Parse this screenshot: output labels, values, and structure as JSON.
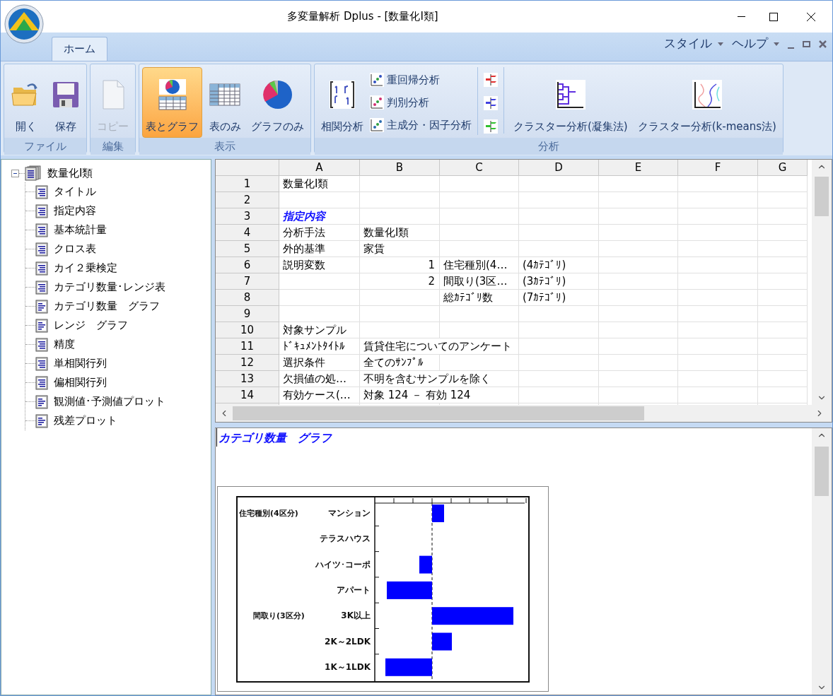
{
  "window": {
    "title": "多変量解析 Dplus - [数量化Ⅰ類]"
  },
  "ribbon": {
    "tabs": [
      {
        "label": "ホーム",
        "selected": true
      }
    ],
    "menus": [
      {
        "label": "スタイル"
      },
      {
        "label": "ヘルプ"
      }
    ],
    "groups": [
      {
        "label": "ファイル",
        "buttons": [
          {
            "kind": "open",
            "label": "開く",
            "disabled": false,
            "selected": false
          },
          {
            "kind": "save",
            "label": "保存",
            "disabled": false,
            "selected": false
          }
        ]
      },
      {
        "label": "編集",
        "buttons": [
          {
            "kind": "copy",
            "label": "コピー",
            "disabled": true,
            "selected": false
          }
        ]
      },
      {
        "label": "表示",
        "buttons": [
          {
            "kind": "table-graph",
            "label": "表とグラフ",
            "disabled": false,
            "selected": true
          },
          {
            "kind": "table",
            "label": "表のみ",
            "disabled": false,
            "selected": false
          },
          {
            "kind": "graph",
            "label": "グラフのみ",
            "disabled": false,
            "selected": false
          }
        ]
      },
      {
        "label": "分析",
        "buttons": [
          {
            "kind": "matrix",
            "label": "相関分析",
            "disabled": false,
            "selected": false
          },
          {
            "kind": "small-list",
            "items": [
              "重回帰分析",
              "判別分析",
              "主成分・因子分析"
            ]
          },
          {
            "kind": "flags"
          },
          {
            "kind": "dendrogram",
            "label": "クラスター分析(凝集法)",
            "disabled": false,
            "selected": false
          },
          {
            "kind": "kmeans",
            "label": "クラスター分析(k-means法)",
            "disabled": false,
            "selected": false
          }
        ]
      }
    ]
  },
  "tree": {
    "label": "数量化Ⅰ類",
    "expanded": true,
    "children": [
      {
        "label": "タイトル",
        "kind": "text"
      },
      {
        "label": "指定内容",
        "kind": "text"
      },
      {
        "label": "基本統計量",
        "kind": "text"
      },
      {
        "label": "クロス表",
        "kind": "text"
      },
      {
        "label": "カイ２乗検定",
        "kind": "text"
      },
      {
        "label": "カテゴリ数量･レンジ表",
        "kind": "text"
      },
      {
        "label": "カテゴリ数量　グラフ",
        "kind": "graph"
      },
      {
        "label": "レンジ　グラフ",
        "kind": "graph"
      },
      {
        "label": "精度",
        "kind": "text"
      },
      {
        "label": "単相関行列",
        "kind": "text"
      },
      {
        "label": "偏相関行列",
        "kind": "text"
      },
      {
        "label": "観測値･予測値プロット",
        "kind": "graph"
      },
      {
        "label": "残差プロット",
        "kind": "graph"
      }
    ]
  },
  "sheet": {
    "columns": [
      "A",
      "B",
      "C",
      "D",
      "E",
      "F",
      "G"
    ],
    "rows": [
      {
        "number": "1",
        "a": "数量化Ⅰ類"
      },
      {
        "number": "2"
      },
      {
        "number": "3",
        "a": "指定内容",
        "kind": "heading"
      },
      {
        "number": "4",
        "a": "分析手法",
        "b": "数量化Ⅰ類"
      },
      {
        "number": "5",
        "a": "外的基準",
        "b": "家賃"
      },
      {
        "number": "6",
        "a": "説明変数",
        "b": "1",
        "c": "住宅種別(4…",
        "d": "(4ｶﾃｺﾞﾘ)"
      },
      {
        "number": "7",
        "b": "2",
        "c": "間取り(3区…",
        "d": "(3ｶﾃｺﾞﾘ)"
      },
      {
        "number": "8",
        "c": "総ｶﾃｺﾞﾘ数",
        "d": "(7ｶﾃｺﾞﾘ)"
      },
      {
        "number": "9"
      },
      {
        "number": "10",
        "a": "対象サンプル"
      },
      {
        "number": "11",
        "a": "ﾄﾞｷｭﾒﾝﾄﾀｲﾄﾙ",
        "b": "賃貸住宅についてのアンケート"
      },
      {
        "number": "12",
        "a": "選択条件",
        "b": "全てのｻﾝﾌﾟﾙ"
      },
      {
        "number": "13",
        "a": "欠損値の処…",
        "b": "不明を含むサンプルを除く"
      },
      {
        "number": "14",
        "a": "有効ケース(…",
        "b": "対象 124 － 有効 124"
      }
    ]
  },
  "graph_pane": {
    "title": "カテゴリ数量　グラフ",
    "chart": {
      "groups": [
        {
          "label": "住宅種別(4区分)",
          "categories": [
            "マンション",
            "テラスハウス",
            "ハイツ･コーポ",
            "アパート"
          ]
        },
        {
          "label": "間取り(3区分)",
          "categories": [
            "3K以上",
            "2K～2LDK",
            "1K～1LDK"
          ]
        }
      ]
    }
  }
}
